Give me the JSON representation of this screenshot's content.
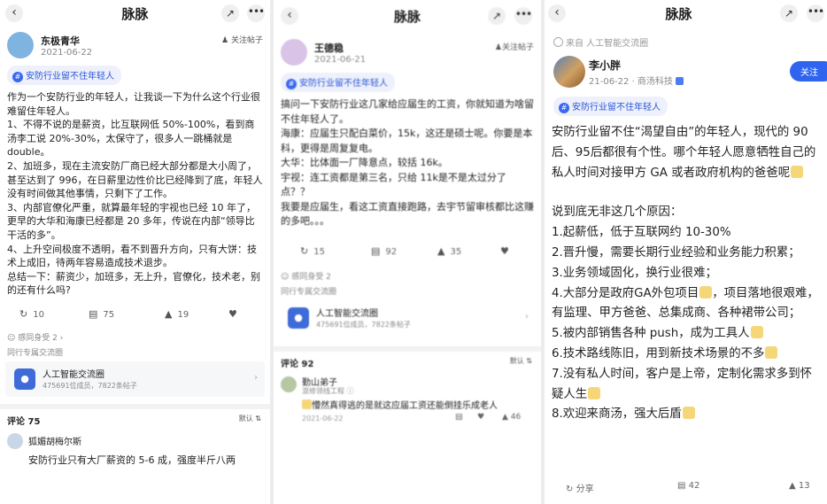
{
  "panel1": {
    "title": "脉脉",
    "author": {
      "name": "东极青华",
      "date": "2021-06-22",
      "follow": "关注帖子"
    },
    "tag": "安防行业留不住年轻人",
    "body": [
      "作为一个安防行业的年轻人，让我谈一下为什么这个行业很难留住年轻人。",
      "1、不得不说的是薪资，比互联网低 50%-100%，看到商汤李工说 20%-30%，太保守了，很多人一跳桶就是double。",
      "2、加班多，现在主流安防厂商已经大部分都是大小周了，甚至达到了 996，在日薪里边性价比已经降到了底，年轻人没有时间做其他事情，只剩下了工作。",
      "3、内部官僚化严重，就算最年轻的宇视也已经 10 年了，更早的大华和海康已经都是 20 多年，传说在内部“领导比干活的多”。",
      "4、上升空间极度不透明，看不到晋升方向，只有大饼：技术上成旧，待两年容易造成技术退步。",
      "总结一下：薪资少，加班多，无上升，官僚化，技术老，别的还有什么吗?"
    ],
    "actions": {
      "share": "10",
      "comments": "75",
      "likes": "19"
    },
    "reaction": "感同身受 2",
    "circle_label": "同行专属交流圈",
    "circle": {
      "name": "人工智能交流圈",
      "meta": "475691位成员，7822条帖子"
    },
    "comments_title": "评论 75",
    "sort": "默认",
    "comment": {
      "name": "狐媚胡梅尔斯",
      "text": "安防行业只有大厂薪资的 5-6 成，强度半斤八两"
    }
  },
  "panel2": {
    "title": "脉脉",
    "author": {
      "name": "王德稳",
      "date": "2021-06-21",
      "follow": "关注帖子"
    },
    "tag": "安防行业留不住年轻人",
    "body": [
      "搞问一下安防行业这几家给应届生的工资，你就知道为啥留不住年轻人了。",
      "海康：应届生只配白菜价，15k，这还是硕士呢。你要是本科，更得是周复复电。",
      "大华：比体面一厂降意点，较括 16k。",
      "宇视：连工资都是第三名，只给 11k是不是太过分了点？？",
      "我要是应届生，看这工资直接跑路，去宇节留审核都比这赚的多吧。。。"
    ],
    "actions": {
      "share": "15",
      "comments": "92",
      "likes": "35"
    },
    "reaction": "感同身受 2",
    "circle_label": "同行专属交流圈",
    "circle": {
      "name": "人工智能交流圈",
      "meta": "475691位成员，7822条帖子"
    },
    "comments_title": "评论 92",
    "sort": "默认",
    "comment": {
      "name": "勤山弟子",
      "meta": "混修领线工程 ⓘ",
      "text": "懵然真得逃的是就这应届工资还能倒挂乐成老人",
      "date": "2021-06-22",
      "likes": "46"
    }
  },
  "panel3": {
    "title": "脉脉",
    "from": "来自 人工智能交流圈",
    "author": {
      "name": "李小胖",
      "date": "21-06-22 · 商汤科技",
      "follow": "关注"
    },
    "tag": "安防行业留不住年轻人",
    "intro": "安防行业留不住“渴望自由”的年轻人，现代的 90 后、95后都很有个性。哪个年轻人愿意牺牲自己的私人时间对接甲方 GA 或者政府机构的爸爸呢",
    "reasons_title": "说到底无非这几个原因：",
    "reasons": [
      "1.起薪低，低于互联网约 10-30%",
      "2.晋升慢，需要长期行业经验和业务能力积累；",
      "3.业务领域固化，换行业很难；",
      "4.大部分是政府GA外包项目",
      "，项目落地很艰难，有监理、甲方爸爸、总集成商、各种裙带公司；",
      "5.被内部销售各种 push，成为工具人",
      "6.技术路线陈旧，用到新技术场景的不多",
      "7.没有私人时间，客户是上帝，定制化需求多到怀疑人生",
      "8.欢迎来商汤，强大后盾"
    ],
    "actions": {
      "share": "分享",
      "comments": "42",
      "likes": "13"
    }
  }
}
